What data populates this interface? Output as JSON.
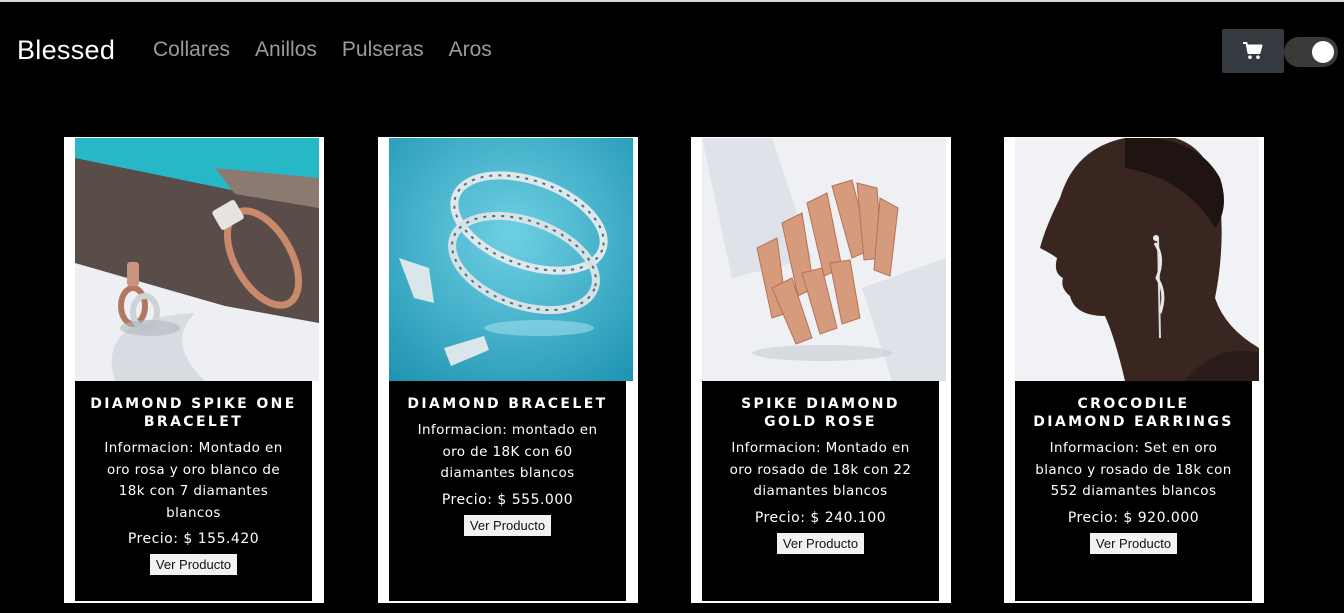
{
  "nav": {
    "brand": "Blessed",
    "links": [
      "Collares",
      "Anillos",
      "Pulseras",
      "Aros"
    ]
  },
  "colors": {
    "background": "#000000",
    "nav_link": "#9b9b9b",
    "cart_button": "#343a40"
  },
  "icons": {
    "cart": "shopping-cart-icon",
    "toggle": "theme-toggle"
  },
  "products": [
    {
      "title": "DIAMOND SPIKE ONE BRACELET",
      "info": "Informacion: Montado en oro rosa y oro blanco de 18k con 7 diamantes blancos",
      "price": "Precio: $ 155.420",
      "button": "Ver Producto"
    },
    {
      "title": "DIAMOND BRACELET",
      "info": "Informacion: montado en oro de 18K con 60 diamantes blancos",
      "price": "Precio: $ 555.000",
      "button": "Ver Producto"
    },
    {
      "title": "SPIKE DIAMOND GOLD ROSE",
      "info": "Informacion: Montado en oro rosado de 18k con 22 diamantes blancos",
      "price": "Precio: $ 240.100",
      "button": "Ver Producto"
    },
    {
      "title": "CROCODILE DIAMOND EARRINGS",
      "info": "Informacion: Set en oro blanco y rosado de 18k con 552 diamantes blancos",
      "price": "Precio: $ 920.000",
      "button": "Ver Producto"
    }
  ]
}
